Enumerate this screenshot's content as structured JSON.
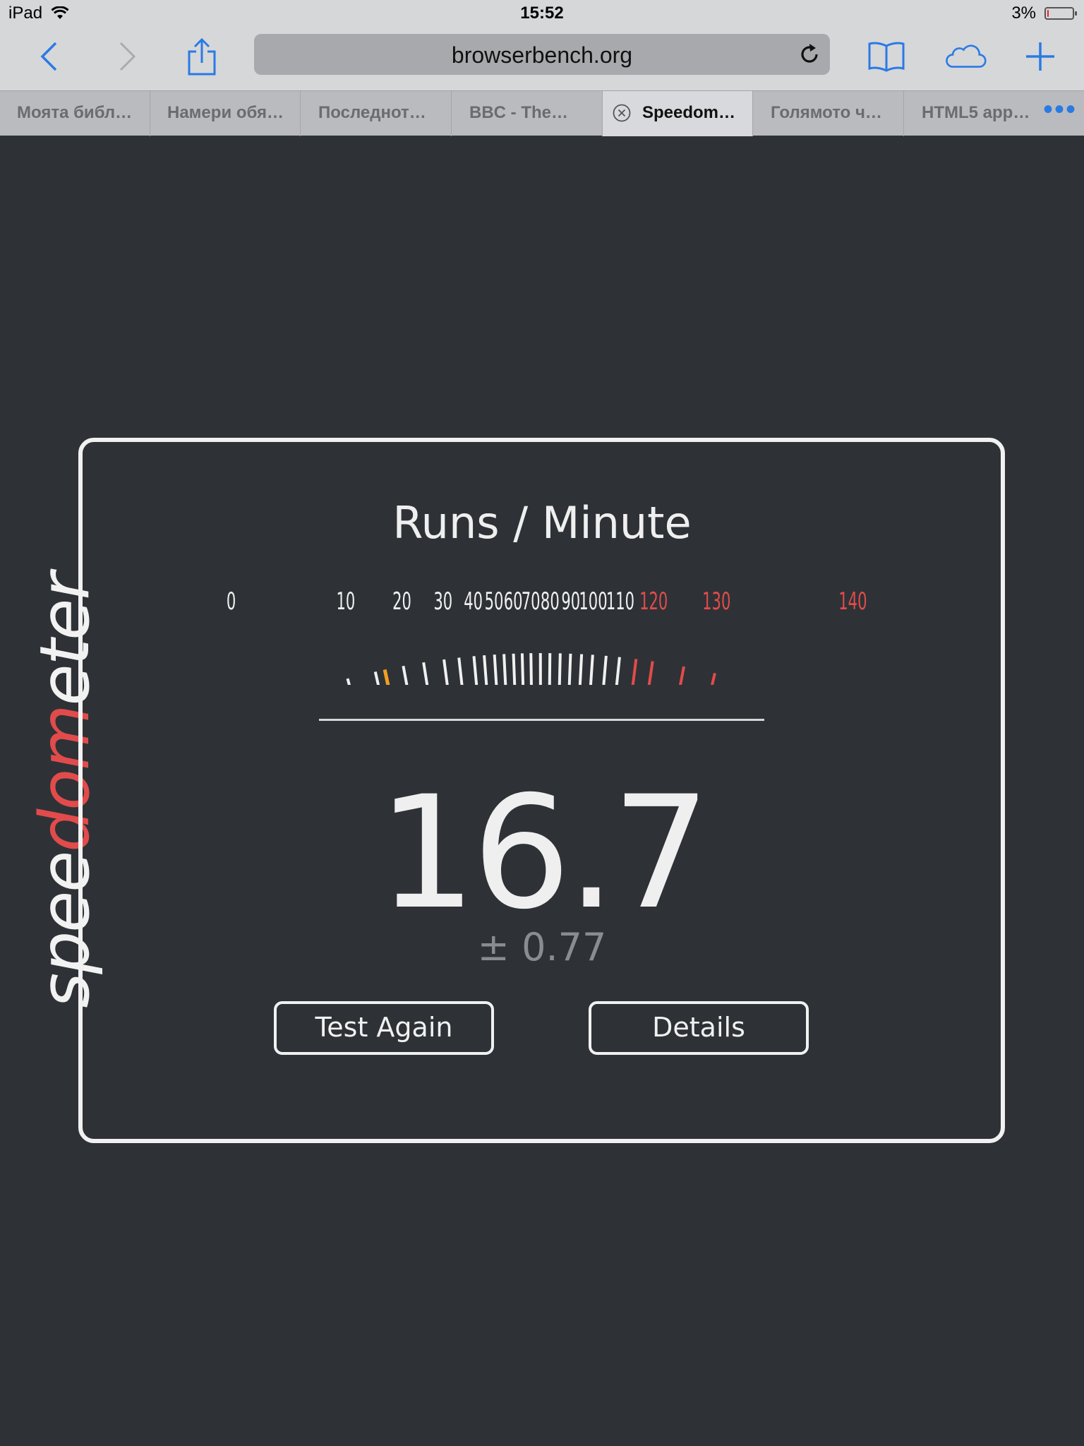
{
  "status_bar": {
    "device": "iPad",
    "time": "15:52",
    "battery_percent": "3%",
    "battery_level": 0.03
  },
  "toolbar": {
    "url": "browserbench.org"
  },
  "tabs": [
    {
      "label": "Моята библ…"
    },
    {
      "label": "Намери обя…"
    },
    {
      "label": "Последнот…"
    },
    {
      "label": "BBC - The…"
    },
    {
      "label": "Speedom…",
      "active": true
    },
    {
      "label": "Голямото ч…"
    },
    {
      "label": "HTML5 app…"
    }
  ],
  "page": {
    "logo_parts": [
      "spee",
      "dom",
      "eter"
    ],
    "title": "Runs / Minute",
    "score": "16.7",
    "error": "± 0.77",
    "buttons": {
      "test_again": "Test Again",
      "details": "Details"
    }
  },
  "chart_data": {
    "type": "gauge",
    "title": "Runs / Minute",
    "tick_labels": [
      "0",
      "10",
      "20",
      "30",
      "40",
      "50",
      "60",
      "70",
      "80",
      "90",
      "100",
      "110",
      "120",
      "130",
      "140"
    ],
    "range": [
      0,
      140
    ],
    "value": 16.7,
    "error": 0.77,
    "colors": {
      "normal": "#f0f0f0",
      "warning": "#e24b4b",
      "needle": "#f0a020"
    },
    "warning_from": 120
  }
}
